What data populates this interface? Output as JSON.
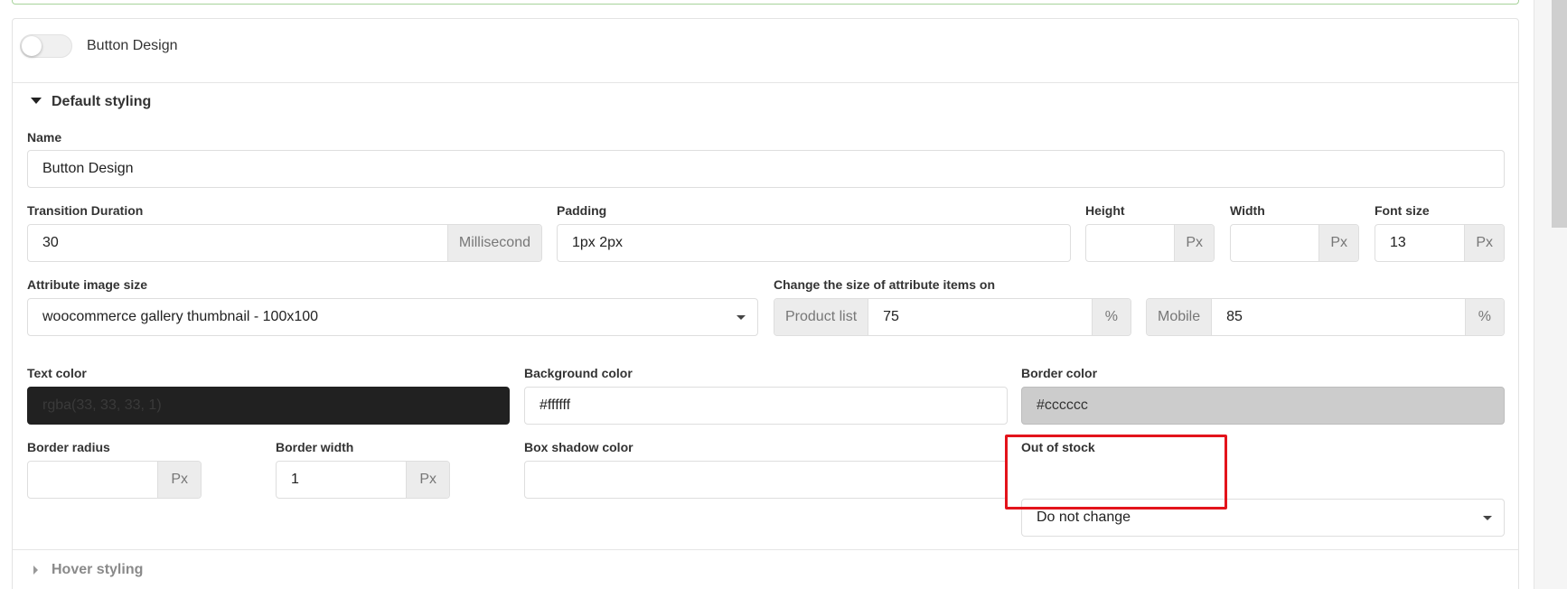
{
  "header": {
    "title": "Button Design",
    "toggle_on": false
  },
  "default_section": {
    "title": "Default styling"
  },
  "name": {
    "label": "Name",
    "value": "Button Design"
  },
  "transition": {
    "label": "Transition Duration",
    "value": "30",
    "unit": "Millisecond"
  },
  "padding": {
    "label": "Padding",
    "value": "1px 2px"
  },
  "height": {
    "label": "Height",
    "value": "",
    "unit": "Px"
  },
  "width": {
    "label": "Width",
    "value": "",
    "unit": "Px"
  },
  "font_size": {
    "label": "Font size",
    "value": "13",
    "unit": "Px"
  },
  "image_size": {
    "label": "Attribute image size",
    "value": "woocommerce gallery thumbnail - 100x100"
  },
  "attr_size": {
    "label": "Change the size of attribute items on",
    "product_list": {
      "prefix": "Product list",
      "value": "75",
      "unit": "%"
    },
    "mobile": {
      "prefix": "Mobile",
      "value": "85",
      "unit": "%"
    }
  },
  "text_color": {
    "label": "Text color",
    "value": "rgba(33, 33, 33, 1)",
    "swatch": "#212121"
  },
  "background_color": {
    "label": "Background color",
    "value": "#ffffff",
    "swatch": "#ffffff"
  },
  "border_color": {
    "label": "Border color",
    "value": "#cccccc",
    "swatch": "#cccccc"
  },
  "border_radius": {
    "label": "Border radius",
    "value": "",
    "unit": "Px"
  },
  "border_width": {
    "label": "Border width",
    "value": "1",
    "unit": "Px"
  },
  "box_shadow": {
    "label": "Box shadow color",
    "value": ""
  },
  "out_of_stock": {
    "label": "Out of stock",
    "value": "Do not change"
  },
  "hover_section": {
    "title": "Hover styling"
  },
  "colors": {
    "highlight": "#e3131b",
    "panel_border": "#e3e3e3",
    "top_border": "#a7d39b"
  }
}
